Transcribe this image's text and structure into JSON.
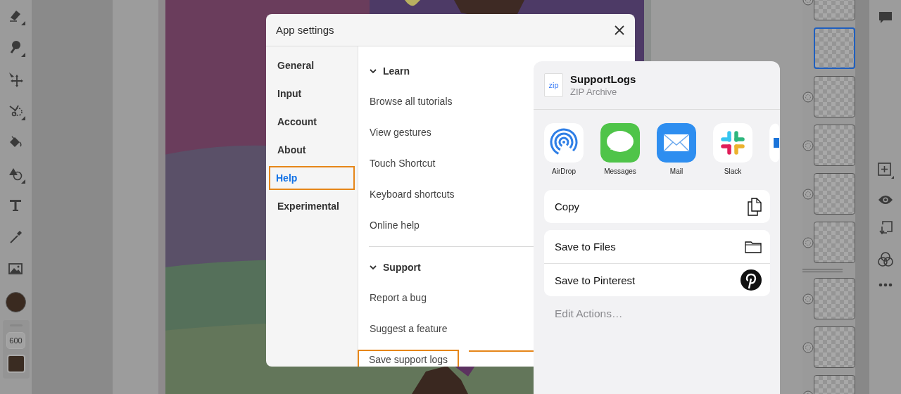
{
  "toolbar": {
    "brush_size": "600"
  },
  "layers": [
    {
      "kind": "layer",
      "selected": false
    },
    {
      "kind": "layer",
      "selected": true
    },
    {
      "kind": "layer",
      "selected": false
    },
    {
      "kind": "layer",
      "selected": false
    },
    {
      "kind": "layer",
      "selected": false
    },
    {
      "kind": "layer",
      "selected": false
    },
    {
      "kind": "divider"
    },
    {
      "kind": "layer",
      "selected": false
    },
    {
      "kind": "layer",
      "selected": false
    },
    {
      "kind": "layer",
      "selected": false
    }
  ],
  "dialog": {
    "title": "App settings",
    "nav": [
      {
        "label": "General",
        "selected": false,
        "highlighted": false
      },
      {
        "label": "Input",
        "selected": false,
        "highlighted": false
      },
      {
        "label": "Account",
        "selected": false,
        "highlighted": false
      },
      {
        "label": "About",
        "selected": false,
        "highlighted": false
      },
      {
        "label": "Help",
        "selected": true,
        "highlighted": true
      },
      {
        "label": "Experimental",
        "selected": false,
        "highlighted": false
      }
    ],
    "sections": [
      {
        "title": "Learn",
        "expanded": true,
        "items": [
          {
            "label": "Browse all tutorials",
            "highlighted": false
          },
          {
            "label": "View gestures",
            "highlighted": false
          },
          {
            "label": "Touch Shortcut",
            "highlighted": false
          },
          {
            "label": "Keyboard shortcuts",
            "highlighted": false
          },
          {
            "label": "Online help",
            "highlighted": false
          }
        ]
      },
      {
        "title": "Support",
        "expanded": true,
        "items": [
          {
            "label": "Report a bug",
            "highlighted": false
          },
          {
            "label": "Suggest a feature",
            "highlighted": false
          },
          {
            "label": "Save support logs",
            "highlighted": true
          }
        ]
      }
    ]
  },
  "share_sheet": {
    "file_name": "SupportLogs",
    "file_type": "ZIP Archive",
    "file_icon_label": "zip",
    "apps": [
      {
        "kind": "airdrop",
        "label": "AirDrop"
      },
      {
        "kind": "messages",
        "label": "Messages"
      },
      {
        "kind": "mail",
        "label": "Mail"
      },
      {
        "kind": "slack",
        "label": "Slack"
      },
      {
        "kind": "cut"
      }
    ],
    "action_groups": [
      [
        {
          "kind": "copy",
          "label": "Copy"
        }
      ],
      [
        {
          "kind": "files",
          "label": "Save to Files"
        },
        {
          "kind": "pinterest",
          "label": "Save to Pinterest"
        }
      ]
    ],
    "edit_actions": "Edit Actions…"
  }
}
